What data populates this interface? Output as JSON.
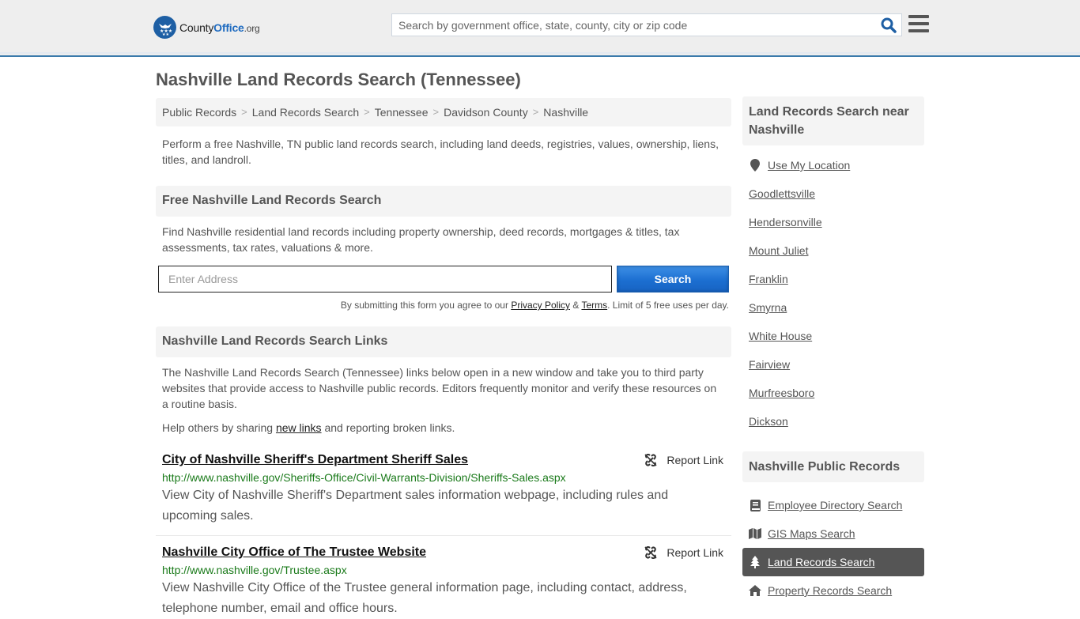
{
  "header": {
    "logo": {
      "county": "County",
      "office": "Office",
      "org": ".org"
    },
    "search_placeholder": "Search by government office, state, county, city or zip code"
  },
  "page_title": "Nashville Land Records Search (Tennessee)",
  "breadcrumb": [
    "Public Records",
    "Land Records Search",
    "Tennessee",
    "Davidson County",
    "Nashville"
  ],
  "intro": "Perform a free Nashville, TN public land records search, including land deeds, registries, values, ownership, liens, titles, and landroll.",
  "free_search": {
    "heading": "Free Nashville Land Records Search",
    "text": "Find Nashville residential land records including property ownership, deed records, mortgages & titles, tax assessments, tax rates, valuations & more.",
    "address_placeholder": "Enter Address",
    "button": "Search",
    "disclaimer_pre": "By submitting this form you agree to our ",
    "privacy_link": "Privacy Policy",
    "amp": " & ",
    "terms_link": "Terms",
    "disclaimer_post": ". Limit of 5 free uses per day."
  },
  "links_section": {
    "heading": "Nashville Land Records Search Links",
    "text": "The Nashville Land Records Search (Tennessee) links below open in a new window and take you to third party websites that provide access to Nashville public records. Editors frequently monitor and verify these resources on a routine basis.",
    "help_pre": "Help others by sharing ",
    "help_link": "new links",
    "help_post": " and reporting broken links.",
    "report_label": "Report Link",
    "results": [
      {
        "title": "City of Nashville Sheriff's Department Sheriff Sales",
        "url": "http://www.nashville.gov/Sheriffs-Office/Civil-Warrants-Division/Sheriffs-Sales.aspx",
        "desc": "View City of Nashville Sheriff's Department sales information webpage, including rules and upcoming sales."
      },
      {
        "title": "Nashville City Office of The Trustee Website",
        "url": "http://www.nashville.gov/Trustee.aspx",
        "desc": "View Nashville City Office of the Trustee general information page, including contact, address, telephone number, email and office hours."
      }
    ]
  },
  "sidebar": {
    "near_heading": "Land Records Search near Nashville",
    "use_location": "Use My Location",
    "nearby": [
      "Goodlettsville",
      "Hendersonville",
      "Mount Juliet",
      "Franklin",
      "Smyrna",
      "White House",
      "Fairview",
      "Murfreesboro",
      "Dickson"
    ],
    "public_heading": "Nashville Public Records",
    "public_items": [
      {
        "label": "Employee Directory Search",
        "icon": "book-icon",
        "active": false
      },
      {
        "label": "GIS Maps Search",
        "icon": "map-icon",
        "active": false
      },
      {
        "label": "Land Records Search",
        "icon": "tree-icon",
        "active": true
      },
      {
        "label": "Property Records Search",
        "icon": "home-icon",
        "active": false
      }
    ]
  },
  "colors": {
    "accent": "#1e6bc0",
    "url_green": "#1a7a1a",
    "active_bg": "#555555",
    "header_border": "#3a7aab"
  }
}
